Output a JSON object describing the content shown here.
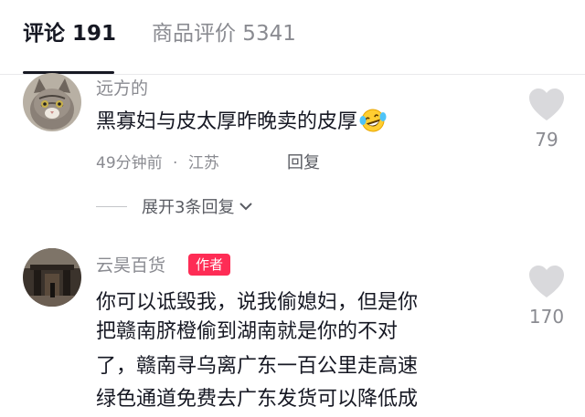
{
  "tabs": [
    {
      "label": "评论 191",
      "active": true
    },
    {
      "label": "商品评价 5341",
      "active": false
    }
  ],
  "comments": [
    {
      "user": "远方的",
      "text": "黑寡妇与皮太厚昨晚卖的皮厚",
      "emoji": "laughing-tears-emoji",
      "time": "49分钟前",
      "separator": "·",
      "location": "江苏",
      "reply_label": "回复",
      "likes": "79",
      "expand_label": "展开3条回复"
    },
    {
      "user": "云昊百货",
      "badge": "作者",
      "lines": [
        "你可以诋毁我，说我偷媳妇，但是你",
        "把赣南脐橙偷到湖南就是你的不对",
        "了，赣南寻乌离广东一百公里走高速",
        "绿色通道免费去广东发货可以降低成"
      ],
      "likes": "170"
    }
  ],
  "colors": {
    "accent": "#fe2c55",
    "text": "#161823",
    "muted": "#8a8b91"
  }
}
